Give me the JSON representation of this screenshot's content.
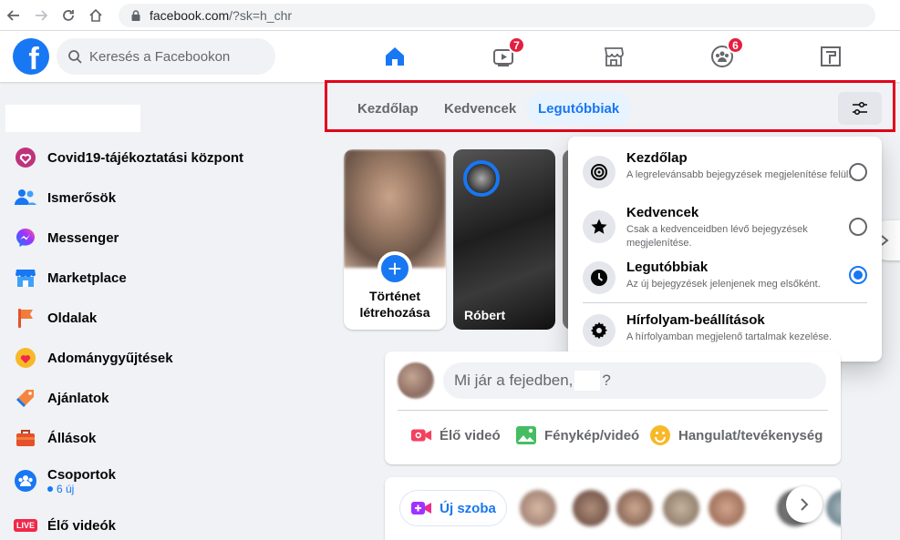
{
  "browser": {
    "url_domain": "facebook.com",
    "url_path": "/?sk=h_chr"
  },
  "header": {
    "logo_letter": "f",
    "search_placeholder": "Keresés a Facebookon",
    "nav": [
      {
        "icon": "home-icon",
        "active": true
      },
      {
        "icon": "watch-icon",
        "badge": "7"
      },
      {
        "icon": "marketplace-icon"
      },
      {
        "icon": "groups-icon",
        "badge": "6"
      },
      {
        "icon": "gaming-icon"
      }
    ]
  },
  "sidebar": {
    "items": [
      {
        "label": "Covid19-tájékoztatási központ",
        "icon": "covid-heart-icon"
      },
      {
        "label": "Ismerősök",
        "icon": "friends-icon"
      },
      {
        "label": "Messenger",
        "icon": "messenger-icon"
      },
      {
        "label": "Marketplace",
        "icon": "marketplace-icon"
      },
      {
        "label": "Oldalak",
        "icon": "flag-icon"
      },
      {
        "label": "Adománygyűjtések",
        "icon": "fundraiser-heart-icon"
      },
      {
        "label": "Ajánlatok",
        "icon": "offers-tag-icon"
      },
      {
        "label": "Állások",
        "icon": "briefcase-icon"
      },
      {
        "label": "Csoportok",
        "icon": "groups-icon",
        "sub": "6 új"
      },
      {
        "label": "Élő videók",
        "icon": "live-icon",
        "badge_text": "LIVE"
      }
    ]
  },
  "feed_tabs": {
    "tabs": [
      {
        "label": "Kezdőlap"
      },
      {
        "label": "Kedvencek"
      },
      {
        "label": "Legutóbbiak",
        "active": true
      }
    ]
  },
  "stories": {
    "create_label": "Történet létrehozása",
    "create_line1": "Történet",
    "create_line2": "létrehozása",
    "friend_name": "Róbert"
  },
  "dropdown": {
    "items": [
      {
        "title": "Kezdőlap",
        "desc": "A legrelevánsabb bejegyzések megjelenítése felül.",
        "icon": "target-icon",
        "selected": false
      },
      {
        "title": "Kedvencek",
        "desc": "Csak a kedvenceidben lévő bejegyzések megjelenítése.",
        "icon": "star-icon",
        "selected": false
      },
      {
        "title": "Legutóbbiak",
        "desc": "Az új bejegyzések jelenjenek meg elsőként.",
        "icon": "clock-icon",
        "selected": true
      }
    ],
    "settings": {
      "title": "Hírfolyam-beállítások",
      "desc": "A hírfolyamban megjelenő tartalmak kezelése.",
      "icon": "gear-icon"
    }
  },
  "composer": {
    "placeholder_start": "Mi jár a fejedben,",
    "placeholder_end": "?",
    "actions": [
      {
        "label": "Élő videó",
        "icon": "live-video-icon",
        "color": "#f3425f"
      },
      {
        "label": "Fénykép/videó",
        "icon": "photo-icon",
        "color": "#45bd62"
      },
      {
        "label": "Hangulat/tevékenység",
        "icon": "feeling-icon",
        "color": "#f7b928"
      }
    ]
  },
  "rooms": {
    "new_room_label": "Új szoba"
  },
  "colors": {
    "brand": "#1877f2",
    "badge": "#e41e3f",
    "highlight_border": "#e2001a"
  }
}
